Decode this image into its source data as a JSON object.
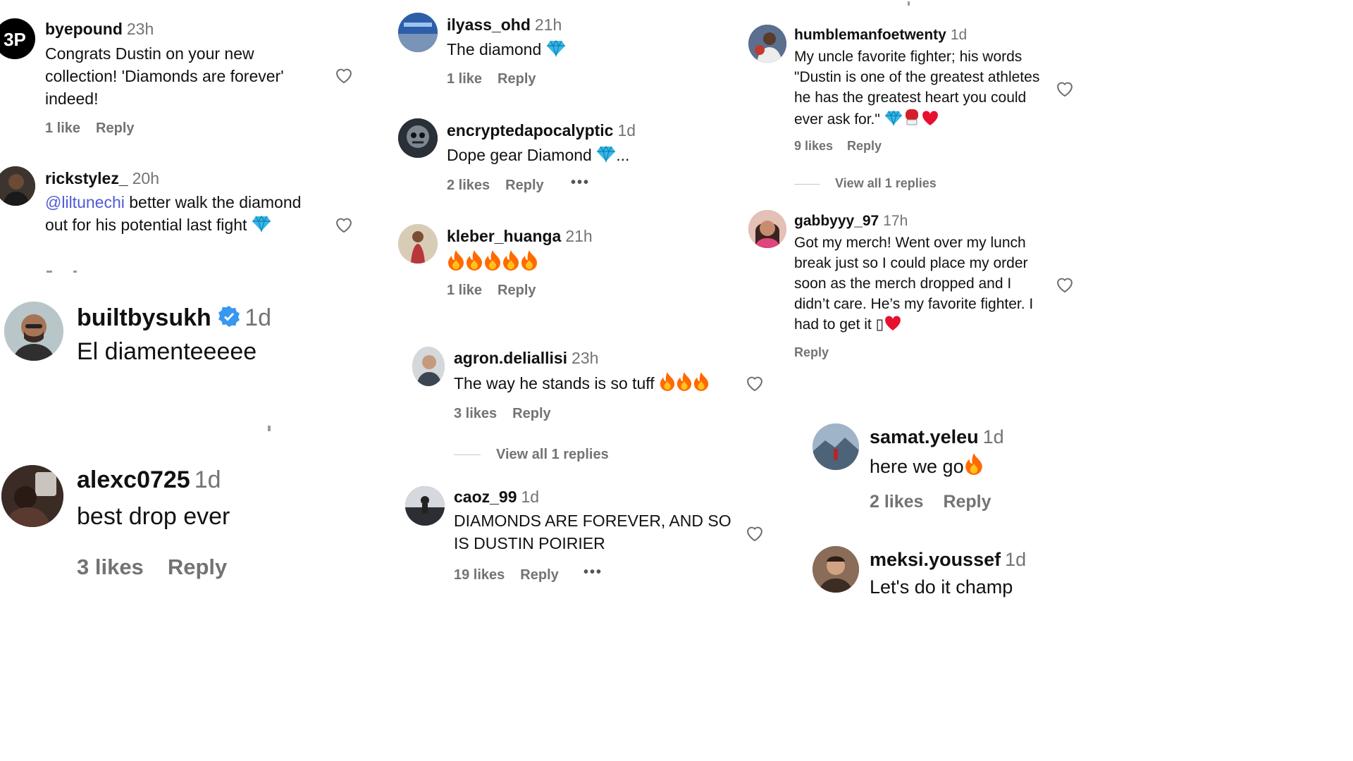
{
  "colors": {
    "text": "#111111",
    "muted": "#737373",
    "mention": "#4f5bd5",
    "verified": "#3897f0",
    "fire": "#ff6a00",
    "diamond": "#37b6e8",
    "heart": "#e8102f"
  },
  "comments": {
    "byepound": {
      "user": "byepound",
      "time": "23h",
      "text": "Congrats Dustin on your new collection! 'Diamonds are forever' indeed!",
      "likes": "1 like",
      "reply": "Reply",
      "avatar_text": "3P"
    },
    "rickstylez": {
      "user": "rickstylez_",
      "time": "20h",
      "mention": "@liltunechi",
      "text": " better walk the diamond out for his potential last fight",
      "emoji": "diamond"
    },
    "builtbysukh": {
      "user": "builtbysukh",
      "time": "1d",
      "text": "El diamenteeeee",
      "verified": true
    },
    "alexc": {
      "user": "alexc0725",
      "time": "1d",
      "text": "best drop ever",
      "likes": "3 likes",
      "reply": "Reply"
    },
    "ilyass": {
      "user": "ilyass_ohd",
      "time": "21h",
      "text": "The diamond",
      "emoji": "diamond",
      "likes": "1 like",
      "reply": "Reply"
    },
    "encrypted": {
      "user": "encryptedapocalyptic",
      "time": "1d",
      "text": "Dope gear Diamond",
      "suffix": "...",
      "likes": "2 likes",
      "reply": "Reply",
      "more": "•••"
    },
    "kleber": {
      "user": "kleber_huanga",
      "time": "21h",
      "likes": "1 like",
      "reply": "Reply",
      "emoji": "fire x5"
    },
    "agron": {
      "user": "agron.deliallisi",
      "time": "23h",
      "text": "The way he stands is so tuff",
      "likes": "3 likes",
      "reply": "Reply",
      "view_all": "View all 1 replies",
      "emoji": "fire x3"
    },
    "caoz": {
      "user": "caoz_99",
      "time": "1d",
      "text": "DIAMONDS ARE FOREVER, AND SO IS DUSTIN POIRIER",
      "likes": "19 likes",
      "reply": "Reply",
      "more": "•••"
    },
    "humble": {
      "user": "humblemanfoetwenty",
      "time": "1d",
      "text": "My uncle favorite fighter; his words \"Dustin is one of the greatest athletes he has the greatest heart you could ever ask for.\"",
      "likes": "9 likes",
      "reply": "Reply",
      "view_all": "View all 1 replies",
      "emoji": "diamond, boxing-glove, heart"
    },
    "gabby": {
      "user": "gabbyyy_97",
      "time": "17h",
      "text": "Got my merch! Went over my lunch break just so I could place my order soon as the merch dropped and I didn’t care. He’s my favorite fighter. I had to get it ▯",
      "reply": "Reply",
      "emoji": "heart"
    },
    "samat": {
      "user": "samat.yeleu",
      "time": "1d",
      "text": "here we go",
      "likes": "2 likes",
      "reply": "Reply",
      "emoji": "fire"
    },
    "meksi": {
      "user": "meksi.youssef",
      "time": "1d",
      "text": "Let's do it champ"
    }
  }
}
